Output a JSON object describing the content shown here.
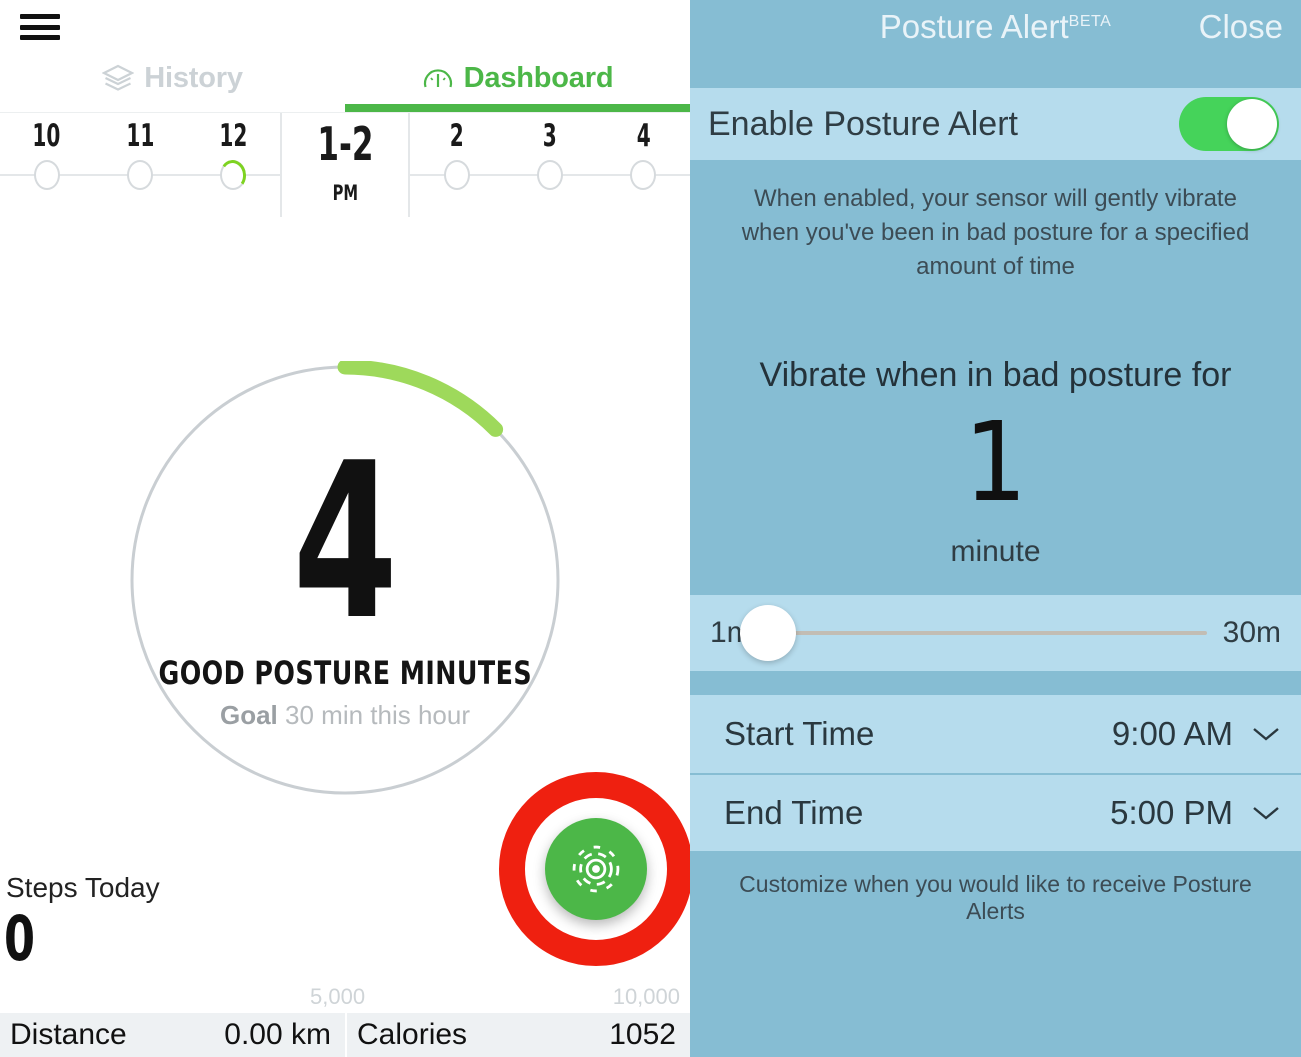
{
  "left": {
    "menu_icon": "hamburger-icon",
    "tabs": [
      {
        "label": "History",
        "icon": "layers-icon",
        "active": false
      },
      {
        "label": "Dashboard",
        "icon": "gauge-icon",
        "active": true
      }
    ],
    "timeline": {
      "hours": [
        "10",
        "11",
        "12"
      ],
      "current": {
        "label": "1-2",
        "ampm": "PM"
      },
      "hours_after": [
        "2",
        "3",
        "4"
      ]
    },
    "gauge": {
      "value": "4",
      "title": "GOOD POSTURE MINUTES",
      "goal_prefix": "Goal",
      "goal_text": "30 min this hour",
      "arc_color": "#9ed95b",
      "track_color": "#c9ced2"
    },
    "fab": {
      "icon": "target-radar-icon",
      "color": "#4cb748",
      "highlight_ring_color": "#ef2010"
    },
    "steps": {
      "label": "Steps Today",
      "value": "0",
      "scale_mid": "5,000",
      "scale_max": "10,000"
    },
    "stats": [
      {
        "name": "Distance",
        "value": "0.00 km"
      },
      {
        "name": "Calories",
        "value": "1052"
      }
    ]
  },
  "right": {
    "title": "Posture Alert",
    "title_sup": "BETA",
    "close_label": "Close",
    "enable_row": {
      "label": "Enable Posture Alert",
      "toggle_on": true,
      "toggle_color": "#45d35a"
    },
    "description": "When enabled, your sensor will gently vibrate when you've been in bad posture for a specified amount of time",
    "question": "Vibrate when in bad posture for",
    "big_number": "1",
    "unit": "minute",
    "slider": {
      "min_label": "1m",
      "max_label": "30m",
      "value_percent": 0
    },
    "rows": [
      {
        "label": "Start Time",
        "value": "9:00 AM",
        "icon": "chevron-down-icon"
      },
      {
        "label": "End Time",
        "value": "5:00 PM",
        "icon": "chevron-down-icon"
      }
    ],
    "footnote": "Customize when you would like to receive Posture Alerts"
  }
}
